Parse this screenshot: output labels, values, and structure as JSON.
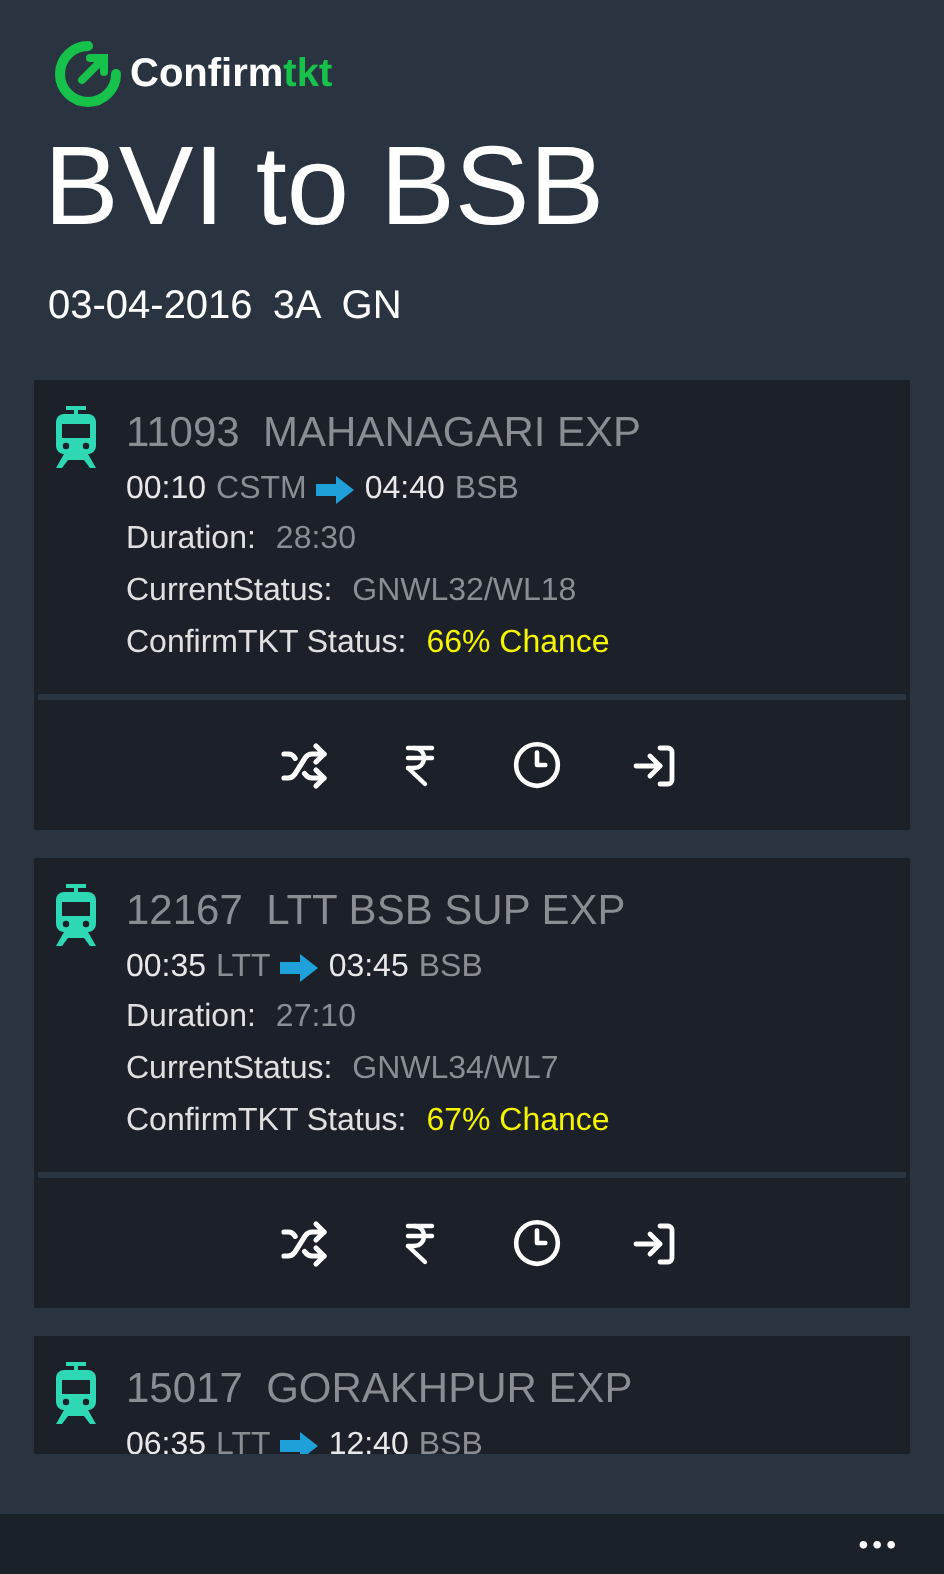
{
  "logo": {
    "brand": "Confirm",
    "accent": "tkt"
  },
  "title": "BVI to BSB",
  "subtitle": [
    "03-04-2016",
    "3A",
    "GN"
  ],
  "trains": [
    {
      "number": "11093",
      "name": "MAHANAGARI EXP",
      "dep_time": "00:10",
      "dep_station": "CSTM",
      "arr_time": "04:40",
      "arr_station": "BSB",
      "duration_label": "Duration:",
      "duration": "28:30",
      "status_label": "CurrentStatus:",
      "status": "GNWL32/WL18",
      "chance_label": "ConfirmTKT Status:",
      "chance": "66% Chance"
    },
    {
      "number": "12167",
      "name": "LTT BSB SUP EXP",
      "dep_time": "00:35",
      "dep_station": "LTT",
      "arr_time": "03:45",
      "arr_station": "BSB",
      "duration_label": "Duration:",
      "duration": "27:10",
      "status_label": "CurrentStatus:",
      "status": "GNWL34/WL7",
      "chance_label": "ConfirmTKT Status:",
      "chance": "67% Chance"
    },
    {
      "number": "15017",
      "name": "GORAKHPUR EXP",
      "dep_time": "06:35",
      "dep_station": "LTT",
      "arr_time": "12:40",
      "arr_station": "BSB"
    }
  ],
  "app_bar": {
    "more": "•••"
  }
}
